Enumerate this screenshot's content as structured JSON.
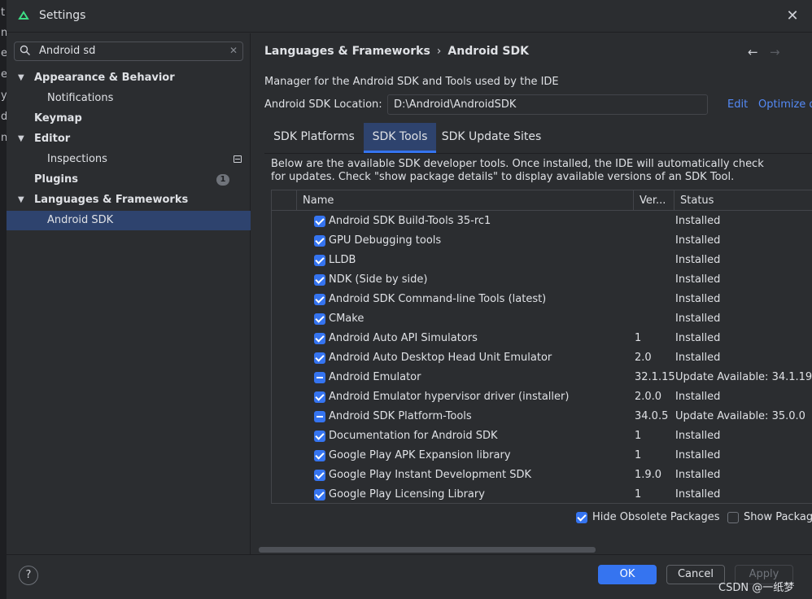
{
  "window": {
    "title": "Settings"
  },
  "edge_letters": [
    "t",
    "n",
    "e",
    "e",
    "y",
    "d",
    "n"
  ],
  "sidebar": {
    "search": {
      "value": "Android sd"
    },
    "items": [
      {
        "label": "Appearance & Behavior",
        "expanded": true
      },
      {
        "label": "Notifications"
      },
      {
        "label": "Keymap"
      },
      {
        "label": "Editor",
        "expanded": true
      },
      {
        "label": "Inspections"
      },
      {
        "label": "Plugins",
        "badge": "1"
      },
      {
        "label": "Languages & Frameworks",
        "expanded": true
      },
      {
        "label": "Android SDK",
        "selected": true
      }
    ]
  },
  "main": {
    "breadcrumb": {
      "parent": "Languages & Frameworks",
      "separator": "›",
      "current": "Android SDK"
    },
    "description": "Manager for the Android SDK and Tools used by the IDE",
    "sdk_location": {
      "label": "Android SDK Location:",
      "value": "D:\\Android\\AndroidSDK"
    },
    "links": {
      "edit": "Edit",
      "optimize": "Optimize d"
    },
    "tabs": [
      {
        "label": "SDK Platforms",
        "active": false
      },
      {
        "label": "SDK Tools",
        "active": true
      },
      {
        "label": "SDK Update Sites",
        "active": false
      }
    ],
    "note_line1": "Below are the available SDK developer tools. Once installed, the IDE will automatically check",
    "note_line2": "for updates. Check \"show package details\" to display available versions of an SDK Tool.",
    "table": {
      "columns": {
        "name": "Name",
        "version": "Ver...",
        "status": "Status"
      },
      "rows": [
        {
          "name": "Android SDK Build-Tools 35-rc1",
          "version": "",
          "status": "Installed",
          "check": "checked"
        },
        {
          "name": "GPU Debugging tools",
          "version": "",
          "status": "Installed",
          "check": "checked"
        },
        {
          "name": "LLDB",
          "version": "",
          "status": "Installed",
          "check": "checked"
        },
        {
          "name": "NDK (Side by side)",
          "version": "",
          "status": "Installed",
          "check": "checked"
        },
        {
          "name": "Android SDK Command-line Tools (latest)",
          "version": "",
          "status": "Installed",
          "check": "checked"
        },
        {
          "name": "CMake",
          "version": "",
          "status": "Installed",
          "check": "checked"
        },
        {
          "name": "Android Auto API Simulators",
          "version": "1",
          "status": "Installed",
          "check": "checked"
        },
        {
          "name": "Android Auto Desktop Head Unit Emulator",
          "version": "2.0",
          "status": "Installed",
          "check": "checked"
        },
        {
          "name": "Android Emulator",
          "version": "32.1.15",
          "status": "Update Available: 34.1.19",
          "check": "partial"
        },
        {
          "name": "Android Emulator hypervisor driver (installer)",
          "version": "2.0.0",
          "status": "Installed",
          "check": "checked"
        },
        {
          "name": "Android SDK Platform-Tools",
          "version": "34.0.5",
          "status": "Update Available: 35.0.0",
          "check": "partial"
        },
        {
          "name": "Documentation for Android SDK",
          "version": "1",
          "status": "Installed",
          "check": "checked"
        },
        {
          "name": "Google Play APK Expansion library",
          "version": "1",
          "status": "Installed",
          "check": "checked"
        },
        {
          "name": "Google Play Instant Development SDK",
          "version": "1.9.0",
          "status": "Installed",
          "check": "checked"
        },
        {
          "name": "Google Play Licensing Library",
          "version": "1",
          "status": "Installed",
          "check": "checked"
        }
      ]
    },
    "options": {
      "hide_obsolete": {
        "label": "Hide Obsolete Packages",
        "checked": true
      },
      "show_details": {
        "label": "Show Packag",
        "checked": false
      }
    }
  },
  "footer": {
    "help": "?",
    "ok": "OK",
    "cancel": "Cancel",
    "apply": "Apply",
    "watermark": "CSDN @一纸梦"
  },
  "colors": {
    "background": "#2b2d30",
    "selection": "#2e436e",
    "accent": "#3574f0",
    "link": "#548af7"
  }
}
